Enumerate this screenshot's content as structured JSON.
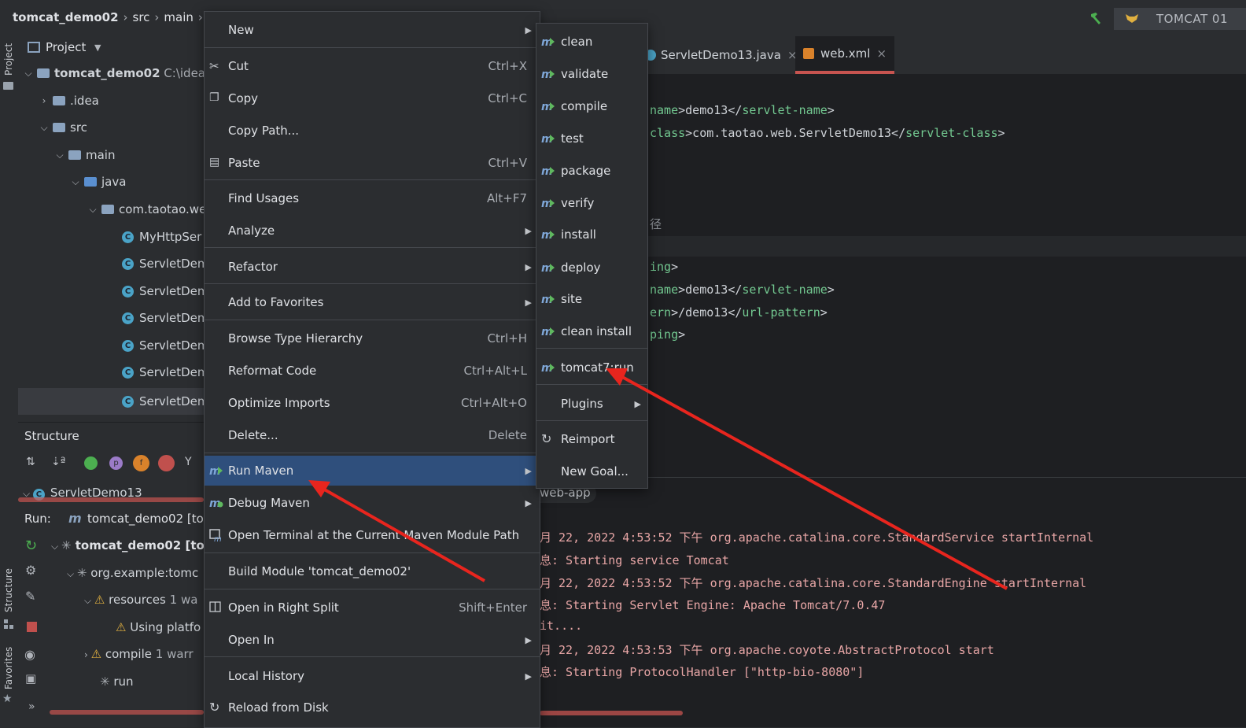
{
  "breadcrumb": {
    "project": "tomcat_demo02",
    "p1": "src",
    "p2": "main"
  },
  "run_config": {
    "label": "TOMCAT 01"
  },
  "left_strip": {
    "project": "Project",
    "structure": "Structure",
    "favorites": "Favorites"
  },
  "project_panel": {
    "title": "Project",
    "root": {
      "name": "tomcat_demo02",
      "path": "C:\\idea\\"
    },
    "items": [
      {
        "name": ".idea"
      },
      {
        "name": "src"
      },
      {
        "name": "main"
      },
      {
        "name": "java"
      },
      {
        "name": "com.taotao.we"
      },
      {
        "name": "MyHttpSer"
      },
      {
        "name": "ServletDem"
      },
      {
        "name": "ServletDem"
      },
      {
        "name": "ServletDem"
      },
      {
        "name": "ServletDem"
      },
      {
        "name": "ServletDem"
      },
      {
        "name": "ServletDem"
      }
    ]
  },
  "structure_panel": {
    "title": "Structure",
    "item": "ServletDemo13"
  },
  "run_panel": {
    "label": "Run:",
    "config": "tomcat_demo02 [tor",
    "tree": [
      {
        "text": "tomcat_demo02 [tor"
      },
      {
        "text": "org.example:tomc"
      },
      {
        "text": "resources",
        "extra": "1 wa"
      },
      {
        "text": "Using platfo"
      },
      {
        "text": "compile",
        "extra": "1 warr"
      },
      {
        "text": "run"
      }
    ],
    "more": "»"
  },
  "editor": {
    "tabs": [
      {
        "label": "ServletDemo13.java",
        "close": "×"
      },
      {
        "label": "web.xml",
        "close": "×"
      }
    ],
    "lines": [
      {
        "a": "name",
        "b": ">demo13</",
        "c": "servlet-name",
        "d": ">"
      },
      {
        "a": "class",
        "b": ">com.taotao.web.ServletDemo13</",
        "c": "servlet-class",
        "d": ">"
      },
      {
        "a": "径",
        "b": "",
        "c": "",
        "d": ""
      },
      {
        "a": "ing",
        "b": ">",
        "c": "",
        "d": ""
      },
      {
        "a": "name",
        "b": ">demo13</",
        "c": "servlet-name",
        "d": ">"
      },
      {
        "a": "ern",
        "b": ">/demo13</",
        "c": "url-pattern",
        "d": ">"
      },
      {
        "a": "ping",
        "b": ">",
        "c": "",
        "d": ""
      }
    ]
  },
  "console": {
    "tab": "web-app",
    "lines": [
      "月 22, 2022 4:53:52 下午 org.apache.catalina.core.StandardService startInternal",
      "息: Starting service Tomcat",
      "月 22, 2022 4:53:52 下午 org.apache.catalina.core.StandardEngine startInternal",
      "息: Starting Servlet Engine: Apache Tomcat/7.0.47",
      "it....",
      "月 22, 2022 4:53:53 下午 org.apache.coyote.AbstractProtocol start",
      "息: Starting ProtocolHandler [\"http-bio-8080\"]"
    ]
  },
  "context_menu": {
    "items": [
      {
        "label": "New",
        "shortcut": "",
        "submenu": true
      },
      {
        "label": "Cut",
        "shortcut": "Ctrl+X"
      },
      {
        "label": "Copy",
        "shortcut": "Ctrl+C"
      },
      {
        "label": "Copy Path...",
        "shortcut": ""
      },
      {
        "label": "Paste",
        "shortcut": "Ctrl+V"
      },
      {
        "label": "Find Usages",
        "shortcut": "Alt+F7"
      },
      {
        "label": "Analyze",
        "shortcut": "",
        "submenu": true
      },
      {
        "label": "Refactor",
        "shortcut": "",
        "submenu": true
      },
      {
        "label": "Add to Favorites",
        "shortcut": "",
        "submenu": true
      },
      {
        "label": "Browse Type Hierarchy",
        "shortcut": "Ctrl+H"
      },
      {
        "label": "Reformat Code",
        "shortcut": "Ctrl+Alt+L"
      },
      {
        "label": "Optimize Imports",
        "shortcut": "Ctrl+Alt+O"
      },
      {
        "label": "Delete...",
        "shortcut": "Delete"
      },
      {
        "label": "Run Maven",
        "shortcut": "",
        "submenu": true
      },
      {
        "label": "Debug Maven",
        "shortcut": "",
        "submenu": true
      },
      {
        "label": "Open Terminal at the Current Maven Module Path",
        "shortcut": ""
      },
      {
        "label": "Build Module 'tomcat_demo02'",
        "shortcut": ""
      },
      {
        "label": "Open in Right Split",
        "shortcut": "Shift+Enter"
      },
      {
        "label": "Open In",
        "shortcut": "",
        "submenu": true
      },
      {
        "label": "Local History",
        "shortcut": "",
        "submenu": true
      },
      {
        "label": "Reload from Disk",
        "shortcut": ""
      }
    ],
    "arrow": "▶"
  },
  "maven_submenu": {
    "items": [
      {
        "label": "clean"
      },
      {
        "label": "validate"
      },
      {
        "label": "compile"
      },
      {
        "label": "test"
      },
      {
        "label": "package"
      },
      {
        "label": "verify"
      },
      {
        "label": "install"
      },
      {
        "label": "deploy"
      },
      {
        "label": "site"
      },
      {
        "label": "clean install"
      },
      {
        "label": "tomcat7:run"
      },
      {
        "label": "Plugins"
      },
      {
        "label": "Reimport"
      },
      {
        "label": "New Goal..."
      }
    ]
  },
  "colors": {
    "accent": "#2f4f7c",
    "annotation_arrow": "#e8251e",
    "tab_underline": "#c75450"
  }
}
